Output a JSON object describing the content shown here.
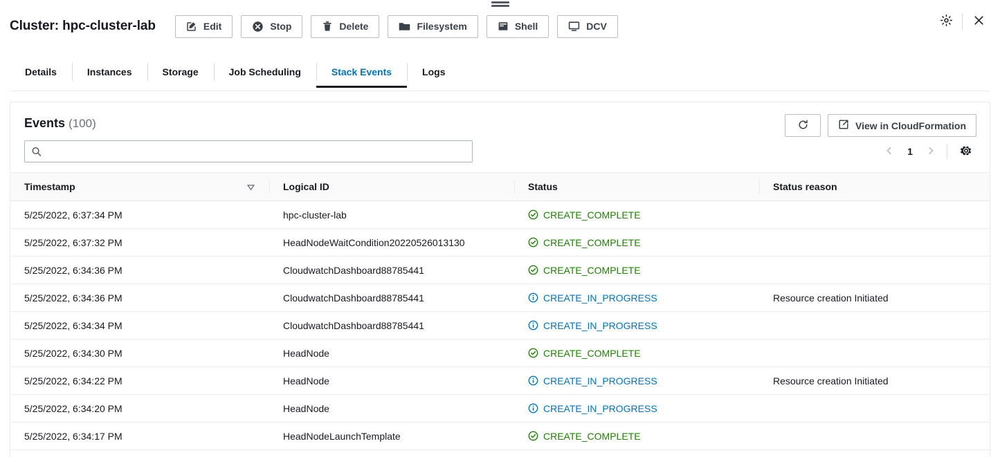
{
  "window": {
    "drag_handle": "drag-handle",
    "settings_icon": "gear-icon",
    "close_icon": "close-icon"
  },
  "header": {
    "title": "Cluster: hpc-cluster-lab",
    "buttons": [
      {
        "label": "Edit",
        "icon": "edit-pencil-icon"
      },
      {
        "label": "Stop",
        "icon": "stop-circle-icon"
      },
      {
        "label": "Delete",
        "icon": "trash-icon"
      },
      {
        "label": "Filesystem",
        "icon": "folder-icon"
      },
      {
        "label": "Shell",
        "icon": "terminal-icon"
      },
      {
        "label": "DCV",
        "icon": "monitor-icon"
      }
    ]
  },
  "tabs": [
    {
      "label": "Details",
      "active": false
    },
    {
      "label": "Instances",
      "active": false
    },
    {
      "label": "Storage",
      "active": false
    },
    {
      "label": "Job Scheduling",
      "active": false
    },
    {
      "label": "Stack Events",
      "active": true
    },
    {
      "label": "Logs",
      "active": false
    }
  ],
  "panel": {
    "title": "Events",
    "count": "(100)",
    "refresh_icon": "refresh-icon",
    "view_cfn_label": "View in CloudFormation",
    "view_cfn_icon": "external-link-icon"
  },
  "search": {
    "value": "",
    "placeholder": "",
    "icon": "search-icon"
  },
  "pagination": {
    "prev_icon": "chevron-left-icon",
    "next_icon": "chevron-right-icon",
    "page": "1",
    "settings_icon": "gear-icon"
  },
  "table": {
    "columns": [
      {
        "label": "Timestamp",
        "sorted": "descending"
      },
      {
        "label": "Logical ID",
        "sorted": ""
      },
      {
        "label": "Status",
        "sorted": ""
      },
      {
        "label": "Status reason",
        "sorted": ""
      }
    ],
    "rows": [
      {
        "timestamp": "5/25/2022, 6:37:34 PM",
        "logical_id": "hpc-cluster-lab",
        "status": "CREATE_COMPLETE",
        "status_kind": "complete",
        "status_reason": ""
      },
      {
        "timestamp": "5/25/2022, 6:37:32 PM",
        "logical_id": "HeadNodeWaitCondition20220526013130",
        "status": "CREATE_COMPLETE",
        "status_kind": "complete",
        "status_reason": ""
      },
      {
        "timestamp": "5/25/2022, 6:34:36 PM",
        "logical_id": "CloudwatchDashboard88785441",
        "status": "CREATE_COMPLETE",
        "status_kind": "complete",
        "status_reason": ""
      },
      {
        "timestamp": "5/25/2022, 6:34:36 PM",
        "logical_id": "CloudwatchDashboard88785441",
        "status": "CREATE_IN_PROGRESS",
        "status_kind": "progress",
        "status_reason": "Resource creation Initiated"
      },
      {
        "timestamp": "5/25/2022, 6:34:34 PM",
        "logical_id": "CloudwatchDashboard88785441",
        "status": "CREATE_IN_PROGRESS",
        "status_kind": "progress",
        "status_reason": ""
      },
      {
        "timestamp": "5/25/2022, 6:34:30 PM",
        "logical_id": "HeadNode",
        "status": "CREATE_COMPLETE",
        "status_kind": "complete",
        "status_reason": ""
      },
      {
        "timestamp": "5/25/2022, 6:34:22 PM",
        "logical_id": "HeadNode",
        "status": "CREATE_IN_PROGRESS",
        "status_kind": "progress",
        "status_reason": "Resource creation Initiated"
      },
      {
        "timestamp": "5/25/2022, 6:34:20 PM",
        "logical_id": "HeadNode",
        "status": "CREATE_IN_PROGRESS",
        "status_kind": "progress",
        "status_reason": ""
      },
      {
        "timestamp": "5/25/2022, 6:34:17 PM",
        "logical_id": "HeadNodeLaunchTemplate",
        "status": "CREATE_COMPLETE",
        "status_kind": "complete",
        "status_reason": ""
      }
    ]
  },
  "colors": {
    "accent": "#0073bb",
    "success": "#1d8102",
    "info": "#0073bb",
    "text": "#16191f",
    "muted": "#687078"
  }
}
